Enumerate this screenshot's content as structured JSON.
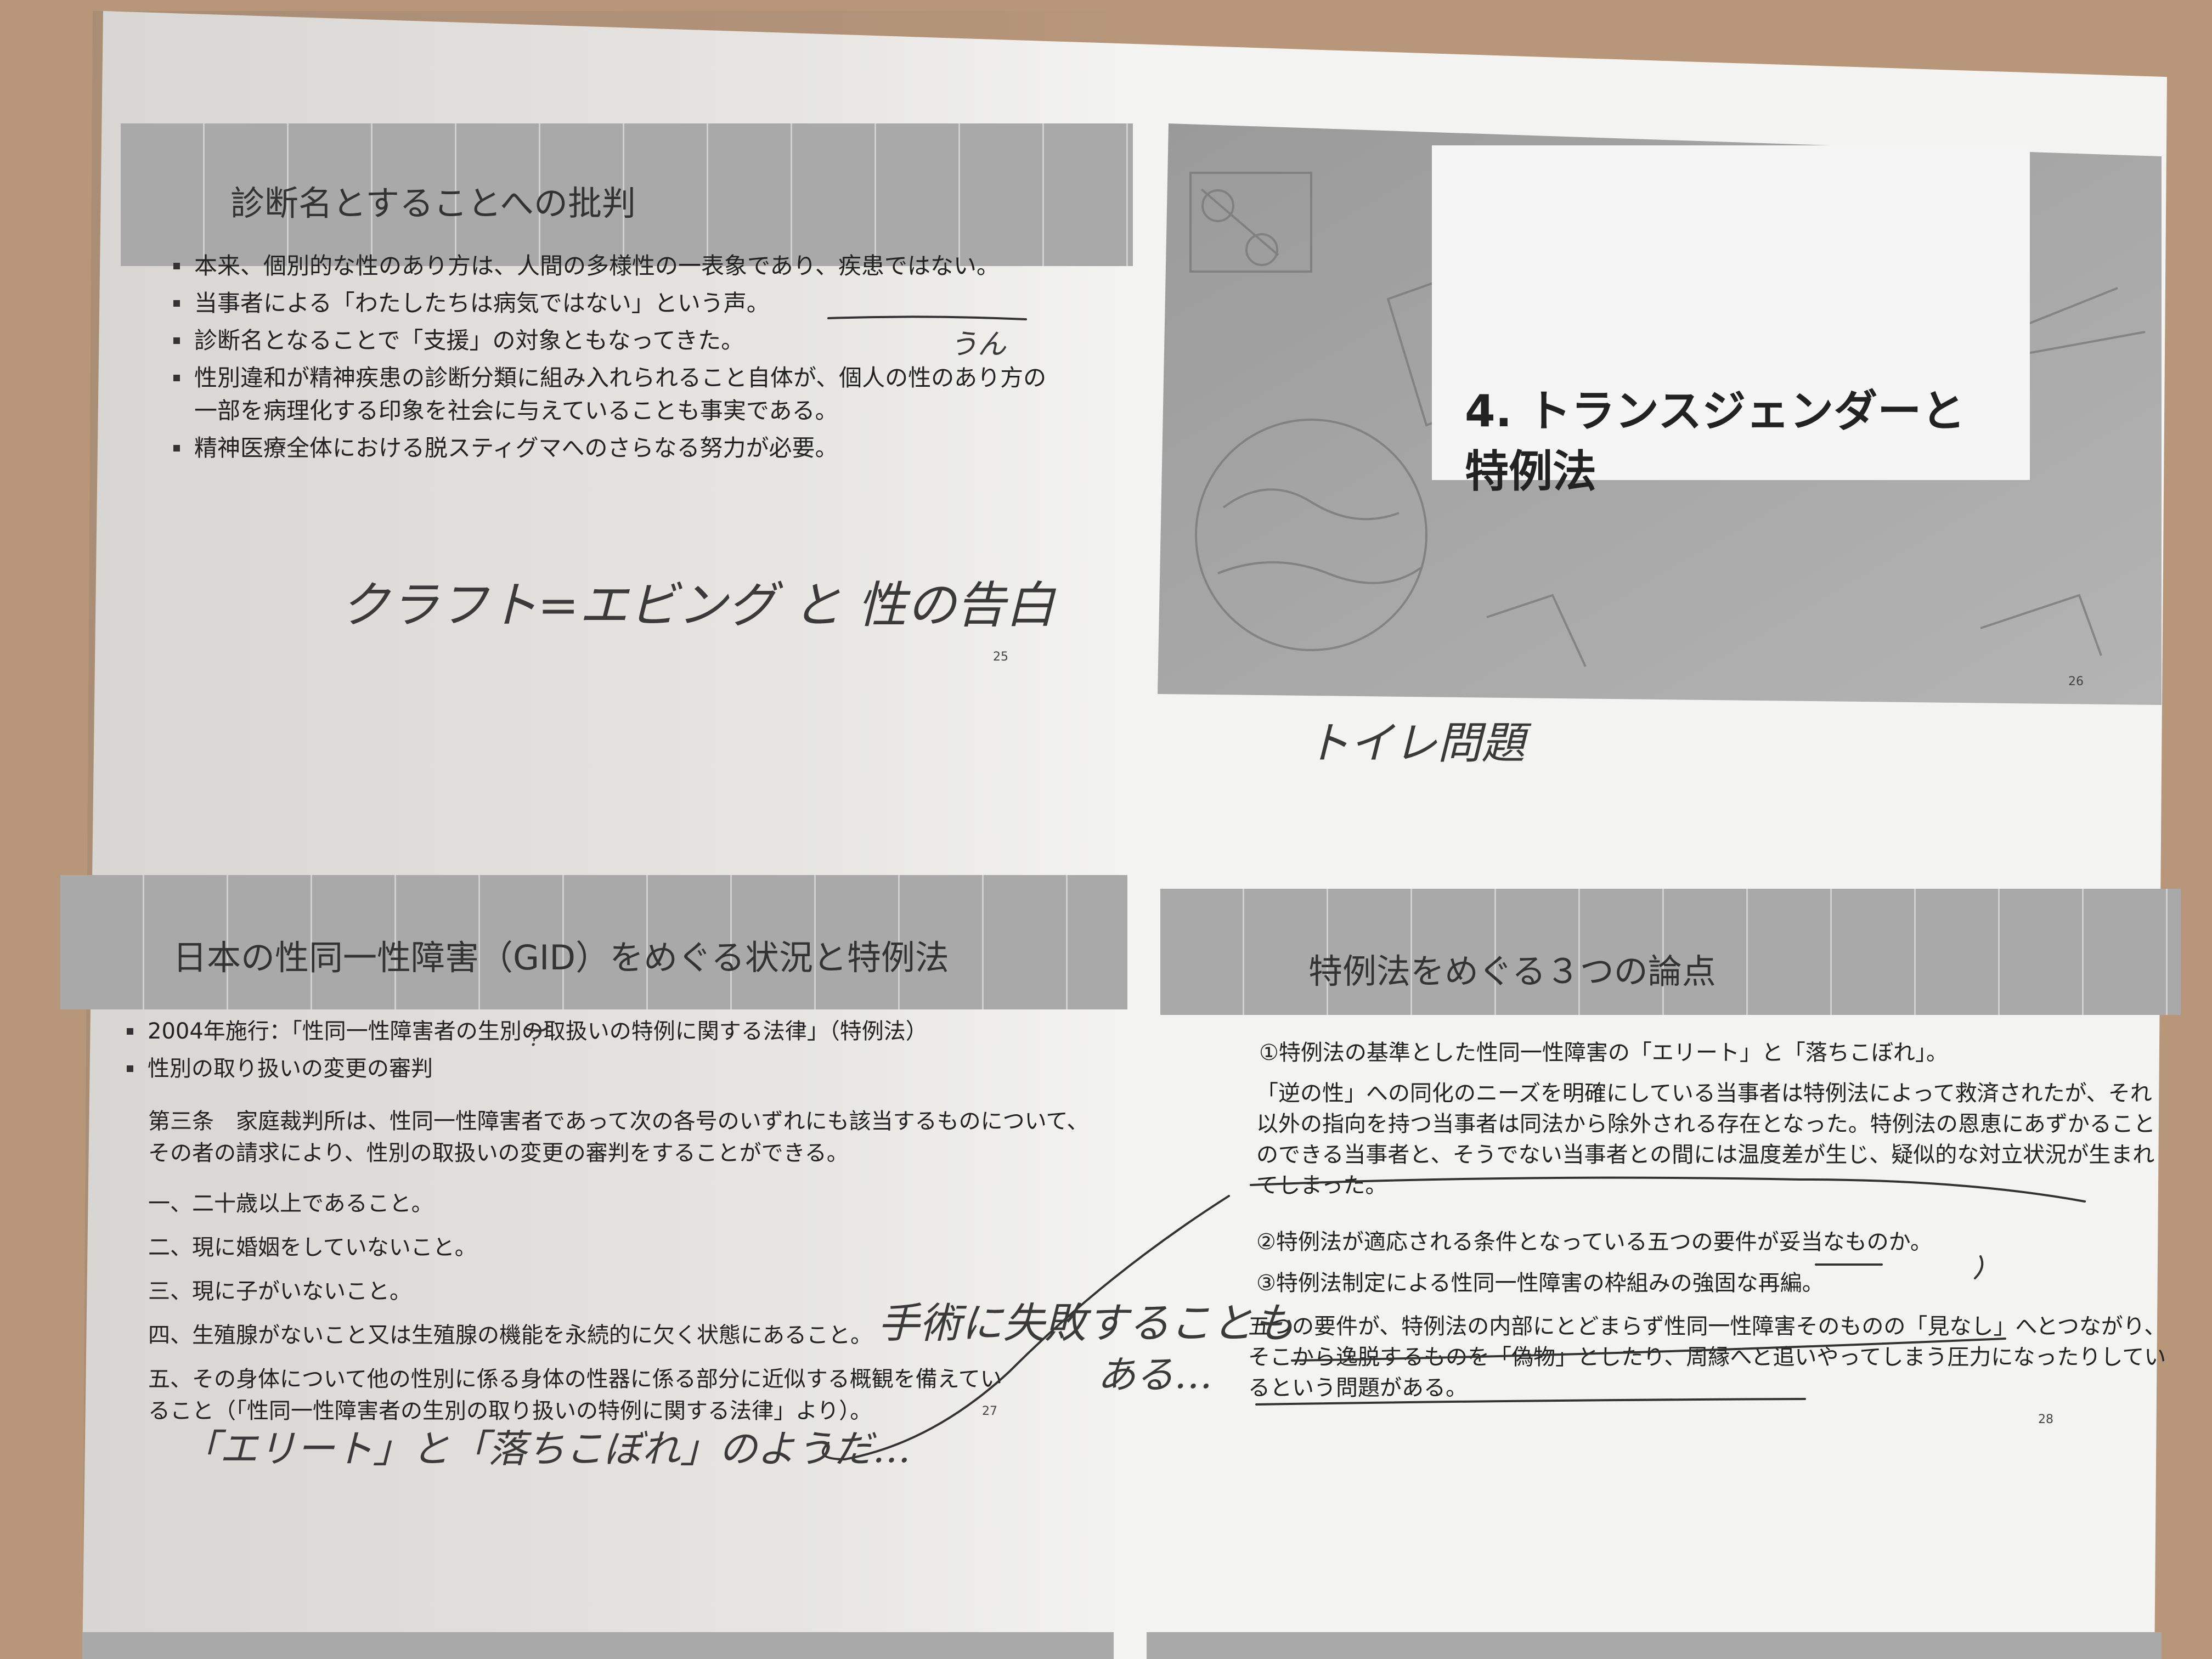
{
  "slide25": {
    "title": "診断名とすることへの批判",
    "bullets": [
      "本来、個別的な性のあり方は、人間の多様性の一表象であり、疾患ではない。",
      "当事者による「わたしたちは病気ではない」という声。",
      "診断名となることで「支援」の対象ともなってきた。",
      "性別違和が精神疾患の診断分類に組み入れられること自体が、個人の性のあり方の一部を病理化する印象を社会に与えていることも事実である。",
      "精神医療全体における脱スティグマへのさらなる努力が必要。"
    ],
    "page": "25"
  },
  "slide26": {
    "section_title": "4. トランスジェンダーと\n特例法",
    "page": "26"
  },
  "slide27": {
    "title": "日本の性同一性障害（GID）をめぐる状況と特例法",
    "bullets": [
      "2004年施行：「性同一性障害者の生別の取扱いの特例に関する法律」（特例法）",
      "性別の取り扱いの変更の審判"
    ],
    "article": "第三条　家庭裁判所は、性同一性障害者であって次の各号のいずれにも該当するものについて、その者の請求により、性別の取扱いの変更の審判をすることができる。",
    "items": [
      "一、二十歳以上であること。",
      "二、現に婚姻をしていないこと。",
      "三、現に子がいないこと。",
      "四、生殖腺がないこと又は生殖腺の機能を永続的に欠く状態にあること。",
      "五、その身体について他の性別に係る身体の性器に係る部分に近似する概観を備えていること（「性同一性障害者の生別の取り扱いの特例に関する法律」より）。"
    ],
    "page": "27"
  },
  "slide28": {
    "title": "特例法をめぐる３つの論点",
    "point1": "①特例法の基準とした性同一性障害の「エリート」と「落ちこぼれ」。",
    "para1": "「逆の性」への同化のニーズを明確にしている当事者は特例法によって救済されたが、それ以外の指向を持つ当事者は同法から除外される存在となった。特例法の恩恵にあずかることのできる当事者と、そうでない当事者との間には温度差が生じ、疑似的な対立状況が生まれてしまった。",
    "point2": "②特例法が適応される条件となっている五つの要件が妥当なものか。",
    "point3": "③特例法制定による性同一性障害の枠組みの強固な再編。",
    "para3": "五つの要件が、特例法の内部にとどまらず性同一性障害そのものの「見なし」へとつながり、そこから逸脱するものを「偽物」としたり、周縁へと追いやってしまう圧力になったりしているという問題がある。",
    "page": "28"
  },
  "handwriting": {
    "note_uun": "うん",
    "note_kraft": "クラフト=エビング と 性の告白",
    "note_toilet": "トイレ問題",
    "note_surgery_1": "手術に失敗することも",
    "note_surgery_2": "ある…",
    "note_elite": "「エリート」と「落ちこぼれ」のようだ…",
    "note_q": "?"
  }
}
